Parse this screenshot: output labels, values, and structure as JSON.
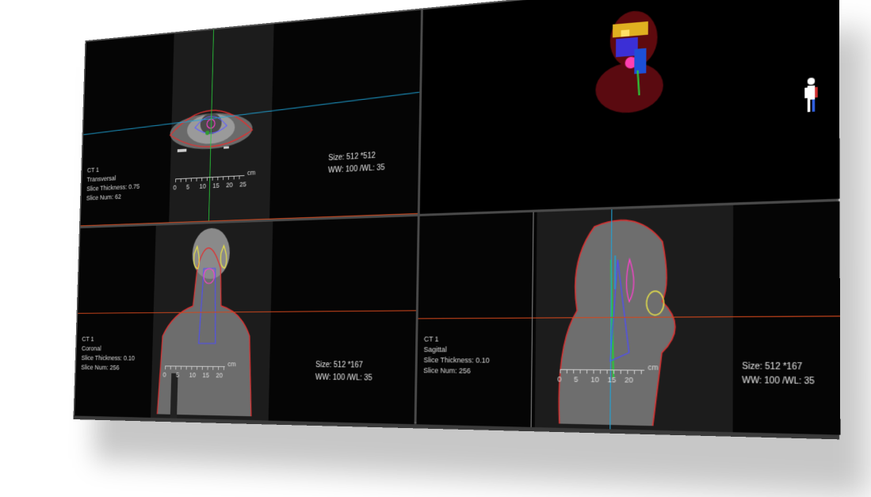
{
  "colors": {
    "background": "#000000",
    "divider": "#4a4a4a",
    "crosshair_horizontal": "#1fa3d6",
    "crosshair_vertical": "#29c93a",
    "body_contour": "#e03030",
    "plane_line": "#d2471c"
  },
  "axial": {
    "ct_label": "CT 1",
    "orientation": "Transversal",
    "thickness": "Slice Thickness: 0.75",
    "slice_num": "Slice Num: 62",
    "size": "Size: 512  *512",
    "window": "WW: 100  /WL: 35",
    "ruler_unit": "cm",
    "ruler_ticks": [
      "0",
      "5",
      "10",
      "15",
      "20",
      "25"
    ]
  },
  "render3d": {
    "icon": "human-orientation-figure"
  },
  "coronal": {
    "ct_label": "CT 1",
    "orientation": "Coronal",
    "thickness": "Slice Thickness: 0.10",
    "slice_num": "Slice Num: 256",
    "size": "Size: 512  *167",
    "window": "WW: 100  /WL: 35",
    "ruler_unit": "cm",
    "ruler_ticks": [
      "0",
      "5",
      "10",
      "15",
      "20"
    ]
  },
  "sagittal": {
    "ct_label": "CT 1",
    "orientation": "Sagittal",
    "thickness": "Slice Thickness: 0.10",
    "slice_num": "Slice Num: 256",
    "size": "Size: 512  *167",
    "window": "WW: 100  /WL: 35",
    "ruler_unit": "cm",
    "ruler_ticks": [
      "0",
      "5",
      "10",
      "15",
      "20"
    ]
  }
}
